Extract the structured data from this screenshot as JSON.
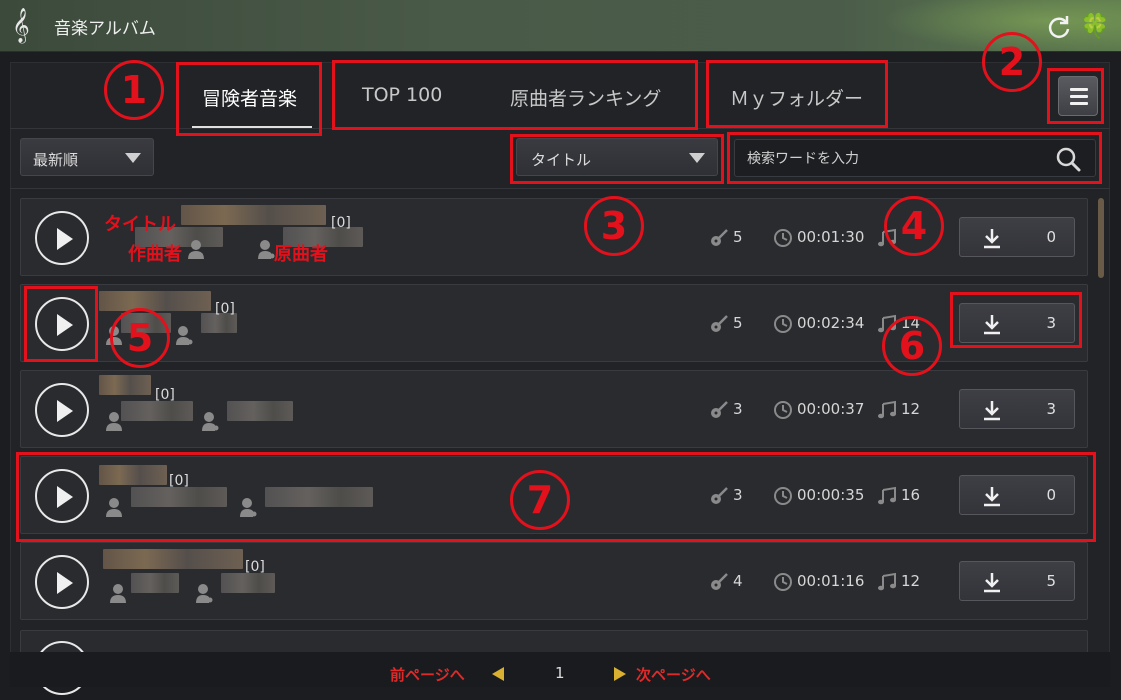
{
  "app": {
    "title": "音楽アルバム",
    "icon": "treble-clef-icon"
  },
  "tabs": [
    {
      "label": "冒険者音楽",
      "active": true
    },
    {
      "label": "TOP 100",
      "active": false
    },
    {
      "label": "原曲者ランキング",
      "active": false
    },
    {
      "label": "Ｍｙフォルダー",
      "active": false
    }
  ],
  "controls": {
    "sort_value": "最新順",
    "search_field_value": "タイトル",
    "search_placeholder": "検索ワードを入力"
  },
  "rows": [
    {
      "count": "[0]",
      "players": "5",
      "duration": "00:01:30",
      "notes": "",
      "downloads": "0"
    },
    {
      "count": "[0]",
      "players": "5",
      "duration": "00:02:34",
      "notes": "14",
      "downloads": "3"
    },
    {
      "count": "[0]",
      "players": "3",
      "duration": "00:00:37",
      "notes": "12",
      "downloads": "3"
    },
    {
      "count": "[0]",
      "players": "3",
      "duration": "00:00:35",
      "notes": "16",
      "downloads": "0"
    },
    {
      "count": "[0]",
      "players": "4",
      "duration": "00:01:16",
      "notes": "12",
      "downloads": "5"
    }
  ],
  "pagination": {
    "prev_label": "前ページへ",
    "page": "1",
    "next_label": "次ページへ"
  },
  "annotations": {
    "num1": "1",
    "num2": "2",
    "num3": "3",
    "num4": "4",
    "num5": "5",
    "num6": "6",
    "num7": "7",
    "title_label": "タイトル",
    "composer_label": "作曲者",
    "original_label": "原曲者"
  },
  "colors": {
    "annotation": "#e3111c",
    "page_arrows": "#d9b030"
  }
}
